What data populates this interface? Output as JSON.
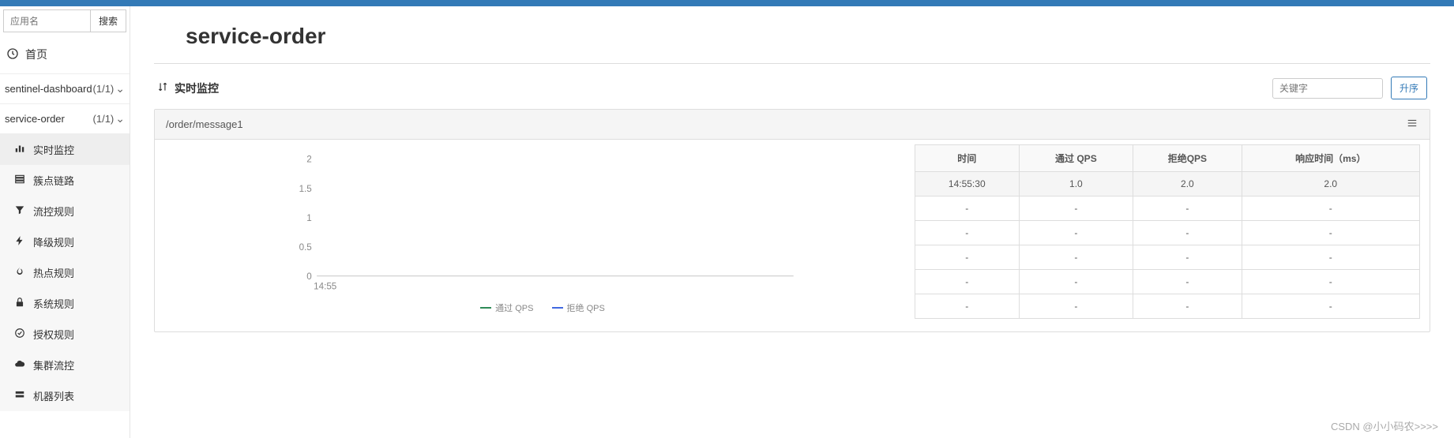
{
  "search": {
    "placeholder": "应用名",
    "button": "搜索"
  },
  "home": "首页",
  "apps": [
    {
      "name": "sentinel-dashboard",
      "count": "(1/1)"
    },
    {
      "name": "service-order",
      "count": "(1/1)"
    }
  ],
  "submenu": {
    "realtime": "实时监控",
    "cluster_point": "簇点链路",
    "flow_rule": "流控规则",
    "degrade_rule": "降级规则",
    "hotspot_rule": "热点规则",
    "system_rule": "系统规则",
    "auth_rule": "授权规则",
    "cluster_flow": "集群流控",
    "machine_list": "机器列表"
  },
  "page_title": "service-order",
  "panel": {
    "title": "实时监控",
    "keyword_placeholder": "关键字",
    "sort_button": "升序"
  },
  "card": {
    "title": "/order/message1"
  },
  "chart_data": {
    "type": "line",
    "x": [
      "14:55"
    ],
    "series": [
      {
        "name": "通过 QPS",
        "values": [
          0
        ],
        "color": "#2e8b57"
      },
      {
        "name": "拒绝 QPS",
        "values": [
          0
        ],
        "color": "#4169e1"
      }
    ],
    "ylim": [
      0,
      2
    ],
    "yticks": [
      0,
      0.5,
      1,
      1.5,
      2
    ],
    "xlabel": "",
    "ylabel": ""
  },
  "table": {
    "headers": [
      "时间",
      "通过 QPS",
      "拒绝QPS",
      "响应时间（ms）"
    ],
    "rows": [
      [
        "14:55:30",
        "1.0",
        "2.0",
        "2.0"
      ],
      [
        "-",
        "-",
        "-",
        "-"
      ],
      [
        "-",
        "-",
        "-",
        "-"
      ],
      [
        "-",
        "-",
        "-",
        "-"
      ],
      [
        "-",
        "-",
        "-",
        "-"
      ],
      [
        "-",
        "-",
        "-",
        "-"
      ]
    ]
  },
  "watermark": "CSDN @小小码农>>>>"
}
